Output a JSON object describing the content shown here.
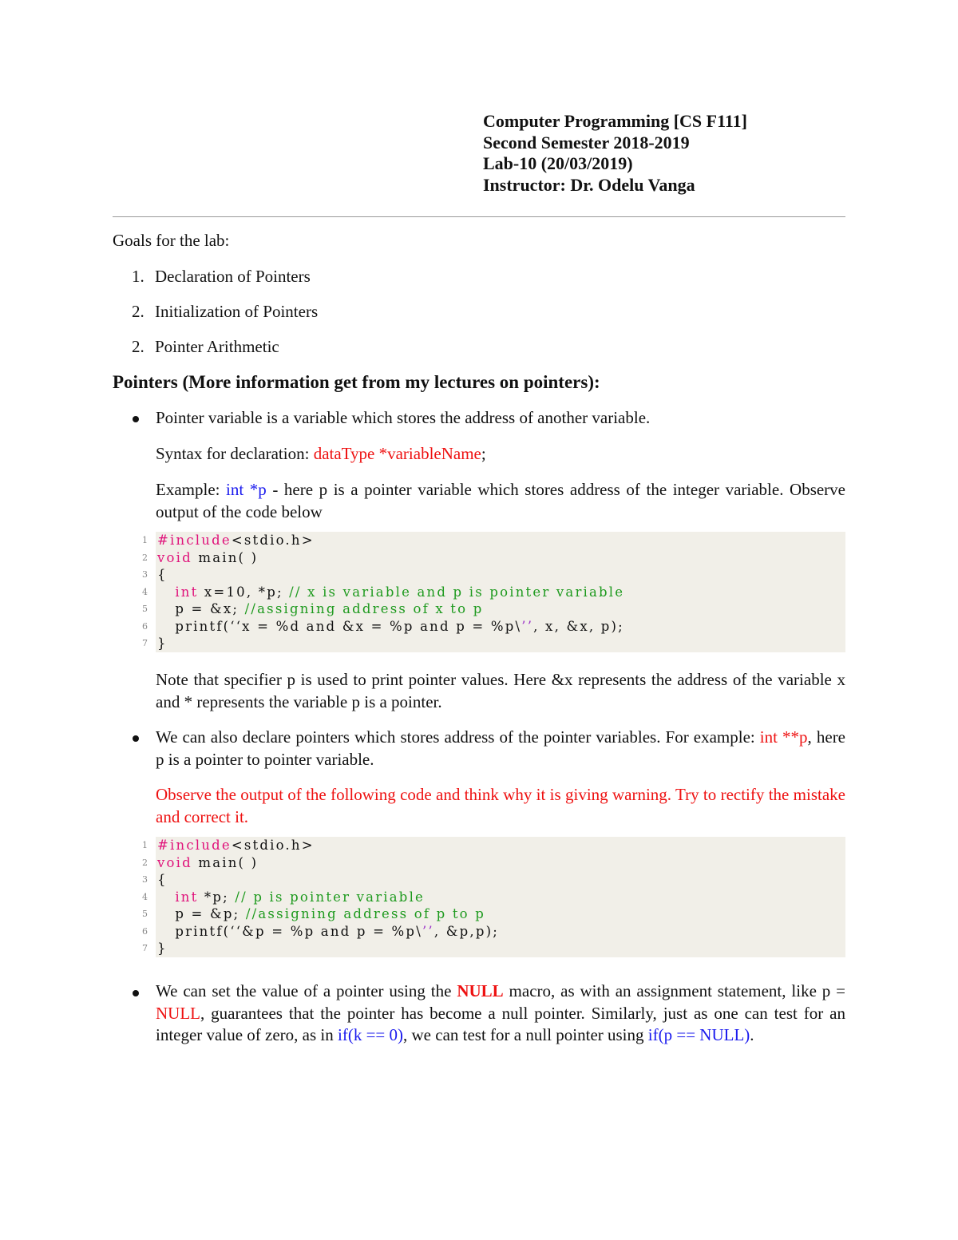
{
  "header": {
    "course": "Computer Programming [CS F111]",
    "semester": "Second Semester 2018-2019",
    "lab": "Lab-10 (20/03/2019)",
    "instructor": "Instructor: Dr. Odelu Vanga"
  },
  "goals": {
    "title": "Goals for the lab:",
    "items": [
      {
        "num": "1.",
        "text": "Declaration of Pointers"
      },
      {
        "num": "2.",
        "text": "Initialization of Pointers"
      },
      {
        "num": "2.",
        "text": "Pointer Arithmetic"
      }
    ]
  },
  "section": {
    "title": "Pointers (More information get from my lectures on pointers):"
  },
  "bullet1": {
    "text": "Pointer variable is a variable which stores the address of another variable.",
    "syntax_label": "Syntax for declaration: ",
    "syntax_code": "dataType *variableName",
    "syntax_end": ";",
    "example_label": "Example: ",
    "example_code": "int *p",
    "example_rest": " - here p is a pointer variable which stores address of the integer variable. Observe output of the code below",
    "note": "Note that specifier p is used to print pointer values. Here &x represents the address of the variable x and * represents the variable p is a pointer."
  },
  "code1": {
    "lines": [
      {
        "n": "1",
        "kw": "#include",
        "text": "<stdio.h>",
        "comment": ""
      },
      {
        "n": "2",
        "kw": "void",
        "text": " main( )",
        "comment": ""
      },
      {
        "n": "3",
        "kw": "",
        "text": "{",
        "comment": ""
      },
      {
        "n": "4",
        "kw": "   int",
        "text": " x=10, *p; ",
        "comment": "// x is variable and p is pointer variable"
      },
      {
        "n": "5",
        "kw": "",
        "text": "   p = &x; ",
        "comment": "//assigning address of x to p"
      },
      {
        "n": "6",
        "kw": "",
        "text": "   printf(‘‘x = %d and &x = %p and p = %p\\",
        "str": "’’",
        "tail": ", x, &x, p);"
      },
      {
        "n": "7",
        "kw": "",
        "text": "}",
        "comment": ""
      }
    ]
  },
  "bullet2": {
    "text": "We can also declare pointers which stores address of the pointer variables. For example: ",
    "code": "int **p",
    "rest": ", here p is a pointer to pointer variable.",
    "warning": "Observe the output of the following code and think why it is giving warning. Try to rectify the mistake and correct it."
  },
  "code2": {
    "lines": [
      {
        "n": "1",
        "kw": "#include",
        "text": "<stdio.h>",
        "comment": ""
      },
      {
        "n": "2",
        "kw": "void",
        "text": " main( )",
        "comment": ""
      },
      {
        "n": "3",
        "kw": "",
        "text": "{",
        "comment": ""
      },
      {
        "n": "4",
        "kw": "   int",
        "text": " *p; ",
        "comment": "// p is pointer variable"
      },
      {
        "n": "5",
        "kw": "",
        "text": "   p = &p; ",
        "comment": "//assigning address of p to p"
      },
      {
        "n": "6",
        "kw": "",
        "text": "   printf(‘‘&p = %p and p = %p\\",
        "str": "’’",
        "tail": ", &p,p);"
      },
      {
        "n": "7",
        "kw": "",
        "text": "}",
        "comment": ""
      }
    ]
  },
  "bullet3": {
    "t1": "We can set the value of a pointer using the ",
    "null_bold": "NULL",
    "t2": " macro, as with an assignment statement, like p = ",
    "null_red": "NULL",
    "t3": ", guarantees that the pointer has become a null pointer. Similarly, just as one can test for an integer value of zero, as in ",
    "if_k": "if(k == 0)",
    "t4": ", we can test for a null pointer using ",
    "if_p": "if(p == NULL)",
    "t5": "."
  },
  "colors": {
    "red": "#ee1111",
    "blue": "#1a1aee",
    "keyword": "#e0117a",
    "comment": "#1e9a1e",
    "code_bg": "#f1efe8"
  }
}
